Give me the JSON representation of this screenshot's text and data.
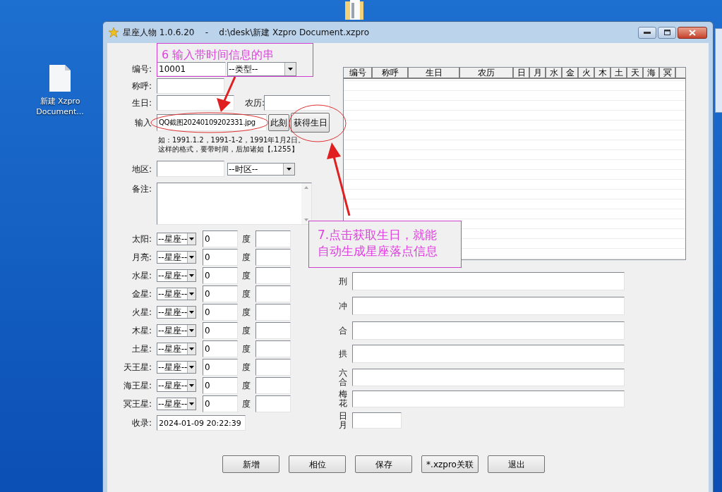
{
  "desktop": {
    "icons": [
      {
        "label": "新建 Xzpro\nDocument..."
      }
    ]
  },
  "window": {
    "title": "星座人物 1.0.6.20    -    d:\\desk\\新建 Xzpro Document.xzpro"
  },
  "form": {
    "id": {
      "label": "编号:",
      "value": "10001",
      "type_select": "--类型--"
    },
    "name": {
      "label": "称呼:"
    },
    "birthday": {
      "label": "生日:",
      "lunar_label": "农历:"
    },
    "input": {
      "label": "输入",
      "value": "QQ截图20240109202331.jpg",
      "now_button": "此刻",
      "get_button": "获得生日"
    },
    "hint_lines": [
      "如：1991.1.2，1991-1-2，1991年1月2日。",
      "这样的格式，要带时间，后加诸如【,1255】"
    ],
    "region": {
      "label": "地区:",
      "timezone_select": "--时区--"
    },
    "notes": {
      "label": "备注:"
    },
    "planets": [
      {
        "label": "太阳:",
        "sign": "--星座--",
        "degree": "0",
        "unit": "度"
      },
      {
        "label": "月亮:",
        "sign": "--星座--",
        "degree": "0",
        "unit": "度"
      },
      {
        "label": "水星:",
        "sign": "--星座--",
        "degree": "0",
        "unit": "度"
      },
      {
        "label": "金星:",
        "sign": "--星座--",
        "degree": "0",
        "unit": "度"
      },
      {
        "label": "火星:",
        "sign": "--星座--",
        "degree": "0",
        "unit": "度"
      },
      {
        "label": "木星:",
        "sign": "--星座--",
        "degree": "0",
        "unit": "度"
      },
      {
        "label": "土星:",
        "sign": "--星座--",
        "degree": "0",
        "unit": "度"
      },
      {
        "label": "天王星:",
        "sign": "--星座--",
        "degree": "0",
        "unit": "度"
      },
      {
        "label": "海王星:",
        "sign": "--星座--",
        "degree": "0",
        "unit": "度"
      },
      {
        "label": "冥王星:",
        "sign": "--星座--",
        "degree": "0",
        "unit": "度"
      }
    ],
    "recorded": {
      "label": "收录:",
      "value": "2024-01-09 20:22:39"
    }
  },
  "table": {
    "columns": [
      "编号",
      "称呼",
      "生日",
      "农历",
      "日",
      "月",
      "水",
      "金",
      "火",
      "木",
      "土",
      "天",
      "海",
      "冥"
    ]
  },
  "aspects": [
    {
      "label": "刑",
      "kind": "wide"
    },
    {
      "label": "冲",
      "kind": "wide"
    },
    {
      "label": "合",
      "kind": "wide"
    },
    {
      "label": "拱",
      "kind": "wide"
    },
    {
      "label": "六合",
      "kind": "wide"
    },
    {
      "label": "梅花",
      "kind": "wide"
    },
    {
      "label": "日月",
      "kind": "short"
    }
  ],
  "buttons": [
    "新增",
    "相位",
    "保存",
    "*.xzpro关联",
    "退出"
  ],
  "annotations": [
    {
      "lines": [
        "6 输入带时间信息的串"
      ]
    },
    {
      "lines": [
        "7.点击获取生日，就能",
        "自动生成星座落点信息"
      ]
    }
  ]
}
